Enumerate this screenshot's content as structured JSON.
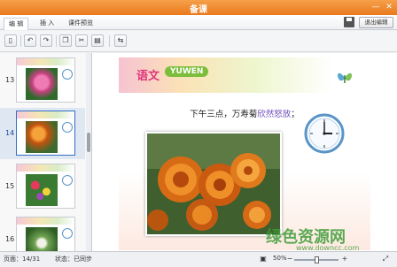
{
  "window": {
    "title": "备课",
    "min_label": "—",
    "close_label": "✕"
  },
  "tabs": [
    {
      "label": "编 辑",
      "active": true
    },
    {
      "label": "插 入",
      "active": false
    },
    {
      "label": "课件预览",
      "active": false
    }
  ],
  "header": {
    "exit_edit_label": "退出编辑"
  },
  "toolbar": {
    "icons": [
      "new-page-icon",
      "undo-icon",
      "redo-icon",
      "copy-icon",
      "cut-icon",
      "paste-icon",
      "replace-icon"
    ]
  },
  "thumbnails": [
    {
      "number": "13",
      "selected": false,
      "photo": "pink flower"
    },
    {
      "number": "14",
      "selected": true,
      "photo": "orange marigold"
    },
    {
      "number": "15",
      "selected": false,
      "photo": "colorful flowers"
    },
    {
      "number": "16",
      "selected": false,
      "photo": "green plant"
    }
  ],
  "slide": {
    "logo_text": "语文",
    "logo_sub": "YUWEN",
    "sentence_prefix": "下午三点，万寿菊",
    "sentence_highlight": "欣然怒放",
    "sentence_suffix": "；",
    "clock_time": "3:00"
  },
  "status": {
    "page_label": "页面：14/31",
    "sync_label": "状态：已同步",
    "zoom_label": "50%",
    "zoom_level": 0.5
  },
  "watermark": {
    "text": "绿色资源网",
    "url": "www.downcc.com"
  },
  "colors": {
    "titlebar": "#ee8a2c",
    "accent": "#2f6fc4",
    "highlight": "#6d4bb8"
  }
}
